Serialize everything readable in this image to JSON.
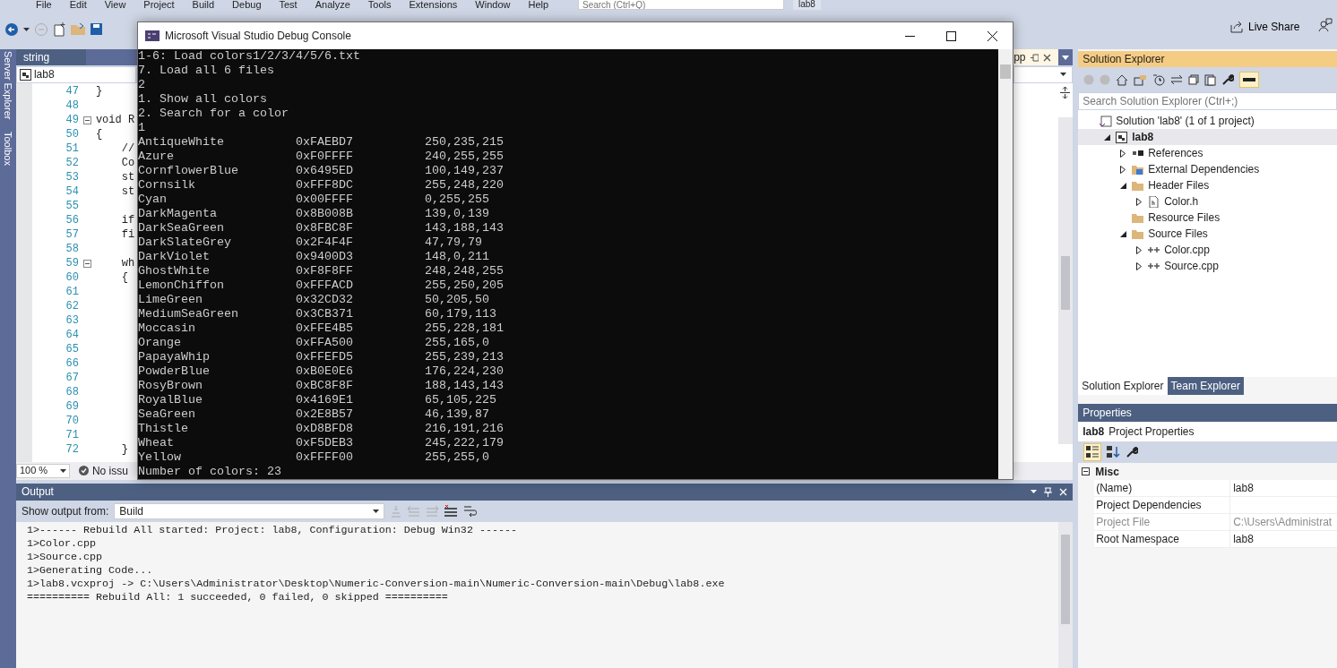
{
  "menu": [
    "File",
    "Edit",
    "View",
    "Project",
    "Build",
    "Debug",
    "Test",
    "Analyze",
    "Tools",
    "Extensions",
    "Window",
    "Help"
  ],
  "search": {
    "placeholder": "Search (Ctrl+Q)"
  },
  "solution_name": "lab8",
  "live_share": "Live Share",
  "side_tabs": [
    "Server Explorer",
    "Toolbox"
  ],
  "editor": {
    "tabs": [
      {
        "label": "string",
        "selected": false
      },
      {
        "label": "pp",
        "selected": true
      }
    ],
    "navigation": "lab8",
    "lines": [
      {
        "number": "47",
        "code": "}",
        "fold": false
      },
      {
        "number": "48",
        "fold": false
      },
      {
        "number": "49",
        "code": "void R",
        "fold": true
      },
      {
        "number": "50",
        "code": "{",
        "fold": false
      },
      {
        "number": "51",
        "code": "    //",
        "fold": false
      },
      {
        "number": "52",
        "code": "    Co",
        "fold": false
      },
      {
        "number": "53",
        "code": "    st",
        "fold": false
      },
      {
        "number": "54",
        "code": "    st",
        "fold": false
      },
      {
        "number": "55",
        "fold": false
      },
      {
        "number": "56",
        "code": "    if",
        "fold": false
      },
      {
        "number": "57",
        "code": "    fi",
        "fold": false
      },
      {
        "number": "58",
        "fold": false
      },
      {
        "number": "59",
        "code": "    wh",
        "fold": true
      },
      {
        "number": "60",
        "code": "    {",
        "fold": false
      },
      {
        "number": "61",
        "fold": false
      },
      {
        "number": "62",
        "fold": false
      },
      {
        "number": "63",
        "fold": false
      },
      {
        "number": "64",
        "fold": false
      },
      {
        "number": "65",
        "fold": false
      },
      {
        "number": "66",
        "fold": false
      },
      {
        "number": "67",
        "fold": false
      },
      {
        "number": "68",
        "fold": false
      },
      {
        "number": "69",
        "fold": false
      },
      {
        "number": "70",
        "fold": false
      },
      {
        "number": "71",
        "fold": false
      },
      {
        "number": "72",
        "code": "    }",
        "fold": false
      }
    ],
    "zoom": "100 %",
    "status": "No issu"
  },
  "console": {
    "title": "Microsoft Visual Studio Debug Console",
    "intro": [
      "1-6: Load colors1/2/3/4/5/6.txt",
      "7. Load all 6 files",
      "2",
      "1. Show all colors",
      "2. Search for a color",
      "1"
    ],
    "colors": [
      {
        "name": "AntiqueWhite",
        "hex": "0xFAEBD7",
        "rgb": "250,235,215"
      },
      {
        "name": "Azure",
        "hex": "0xF0FFFF",
        "rgb": "240,255,255"
      },
      {
        "name": "CornflowerBlue",
        "hex": "0x6495ED",
        "rgb": "100,149,237"
      },
      {
        "name": "Cornsilk",
        "hex": "0xFFF8DC",
        "rgb": "255,248,220"
      },
      {
        "name": "Cyan",
        "hex": "0x00FFFF",
        "rgb": "0,255,255"
      },
      {
        "name": "DarkMagenta",
        "hex": "0x8B008B",
        "rgb": "139,0,139"
      },
      {
        "name": "DarkSeaGreen",
        "hex": "0x8FBC8F",
        "rgb": "143,188,143"
      },
      {
        "name": "DarkSlateGrey",
        "hex": "0x2F4F4F",
        "rgb": "47,79,79"
      },
      {
        "name": "DarkViolet",
        "hex": "0x9400D3",
        "rgb": "148,0,211"
      },
      {
        "name": "GhostWhite",
        "hex": "0xF8F8FF",
        "rgb": "248,248,255"
      },
      {
        "name": "LemonChiffon",
        "hex": "0xFFFACD",
        "rgb": "255,250,205"
      },
      {
        "name": "LimeGreen",
        "hex": "0x32CD32",
        "rgb": "50,205,50"
      },
      {
        "name": "MediumSeaGreen",
        "hex": "0x3CB371",
        "rgb": "60,179,113"
      },
      {
        "name": "Moccasin",
        "hex": "0xFFE4B5",
        "rgb": "255,228,181"
      },
      {
        "name": "Orange",
        "hex": "0xFFA500",
        "rgb": "255,165,0"
      },
      {
        "name": "PapayaWhip",
        "hex": "0xFFEFD5",
        "rgb": "255,239,213"
      },
      {
        "name": "PowderBlue",
        "hex": "0xB0E0E6",
        "rgb": "176,224,230"
      },
      {
        "name": "RosyBrown",
        "hex": "0xBC8F8F",
        "rgb": "188,143,143"
      },
      {
        "name": "RoyalBlue",
        "hex": "0x4169E1",
        "rgb": "65,105,225"
      },
      {
        "name": "SeaGreen",
        "hex": "0x2E8B57",
        "rgb": "46,139,87"
      },
      {
        "name": "Thistle",
        "hex": "0xD8BFD8",
        "rgb": "216,191,216"
      },
      {
        "name": "Wheat",
        "hex": "0xF5DEB3",
        "rgb": "245,222,179"
      },
      {
        "name": "Yellow",
        "hex": "0xFFFF00",
        "rgb": "255,255,0"
      }
    ],
    "summary": "Number of colors: 23"
  },
  "output": {
    "title": "Output",
    "show_from_label": "Show output from:",
    "source": "Build",
    "lines": [
      "1>------ Rebuild All started: Project: lab8, Configuration: Debug Win32 ------",
      "1>Color.cpp",
      "1>Source.cpp",
      "1>Generating Code...",
      "1>lab8.vcxproj -> C:\\Users\\Administrator\\Desktop\\Numeric-Conversion-main\\Numeric-Conversion-main\\Debug\\lab8.exe",
      "========== Rebuild All: 1 succeeded, 0 failed, 0 skipped =========="
    ]
  },
  "solution_explorer": {
    "title": "Solution Explorer",
    "search": {
      "placeholder": "Search Solution Explorer (Ctrl+;)"
    },
    "tree": [
      {
        "label": "Solution 'lab8' (1 of 1 project)",
        "kind": "solution",
        "selected": false,
        "children": [
          {
            "label": "lab8",
            "kind": "project",
            "expanded": true,
            "selected": true,
            "children": [
              {
                "label": "References",
                "kind": "references",
                "expanded": false,
                "selected": false
              },
              {
                "label": "External Dependencies",
                "kind": "external",
                "expanded": false,
                "selected": false
              },
              {
                "label": "Header Files",
                "kind": "folder",
                "expanded": true,
                "selected": false,
                "children": [
                  {
                    "label": "Color.h",
                    "kind": "header",
                    "expanded": false,
                    "selected": false
                  }
                ]
              },
              {
                "label": "Resource Files",
                "kind": "folder",
                "selected": false
              },
              {
                "label": "Source Files",
                "kind": "folder",
                "expanded": true,
                "selected": false,
                "children": [
                  {
                    "label": "Color.cpp",
                    "kind": "cpp",
                    "expanded": false,
                    "selected": false
                  },
                  {
                    "label": "Source.cpp",
                    "kind": "cpp",
                    "expanded": false,
                    "selected": false
                  }
                ]
              }
            ]
          }
        ]
      }
    ],
    "bottom_tabs": [
      {
        "label": "Solution Explorer",
        "selected": true
      },
      {
        "label": "Team Explorer",
        "selected": false
      }
    ]
  },
  "properties": {
    "title": "Properties",
    "object_name": "lab8",
    "object_type": "Project Properties",
    "category": {
      "label": "Misc",
      "expanded": true
    },
    "rows": [
      {
        "name": "(Name)",
        "value": "lab8",
        "disabled": false
      },
      {
        "name": "Project Dependencies",
        "disabled": false
      },
      {
        "name": "Project File",
        "value": "C:\\Users\\Administrat",
        "disabled": true
      },
      {
        "name": "Root Namespace",
        "value": "lab8",
        "disabled": false
      }
    ]
  }
}
